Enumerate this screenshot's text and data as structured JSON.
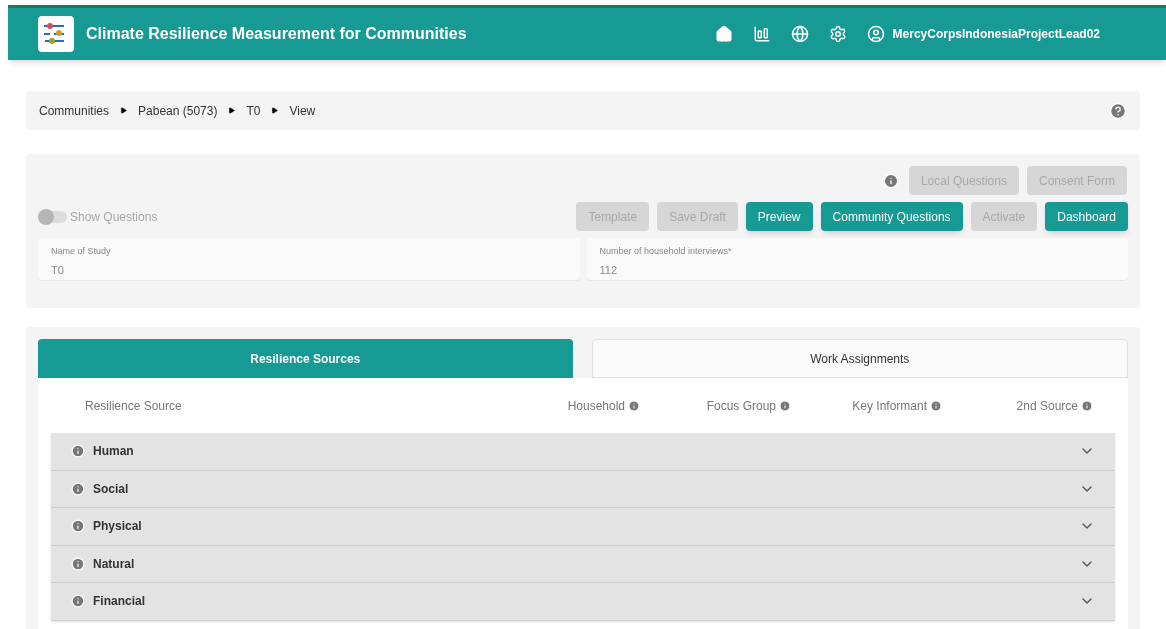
{
  "header": {
    "title": "Climate Resilience Measurement for Communities",
    "user": "MercyCorpsIndonesiaProjectLead02"
  },
  "breadcrumb": [
    "Communities",
    "Pabean (5073)",
    "T0",
    "View"
  ],
  "top_buttons": [
    {
      "label": "Local Questions",
      "disabled": true
    },
    {
      "label": "Consent Form",
      "disabled": true
    }
  ],
  "show_questions": {
    "label": "Show Questions",
    "on": false
  },
  "action_buttons": [
    {
      "label": "Template",
      "disabled": true
    },
    {
      "label": "Save Draft",
      "disabled": true
    },
    {
      "label": "Preview",
      "disabled": false
    },
    {
      "label": "Community Questions",
      "disabled": false
    },
    {
      "label": "Activate",
      "disabled": true
    },
    {
      "label": "Dashboard",
      "disabled": false
    }
  ],
  "fields": [
    {
      "label": "Name of Study",
      "value": "T0"
    },
    {
      "label": "Number of household interviews*",
      "value": "112"
    }
  ],
  "tabs": [
    {
      "label": "Resilience Sources",
      "selected": true
    },
    {
      "label": "Work Assignments",
      "selected": false
    }
  ],
  "columns": [
    "Resilience Source",
    "Household",
    "Focus Group",
    "Key Informant",
    "2nd Source"
  ],
  "sources": [
    {
      "name": "Human",
      "expanded": false
    },
    {
      "name": "Social",
      "expanded": false
    },
    {
      "name": "Physical",
      "expanded": false
    },
    {
      "name": "Natural",
      "expanded": false
    },
    {
      "name": "Financial",
      "expanded": false
    }
  ]
}
